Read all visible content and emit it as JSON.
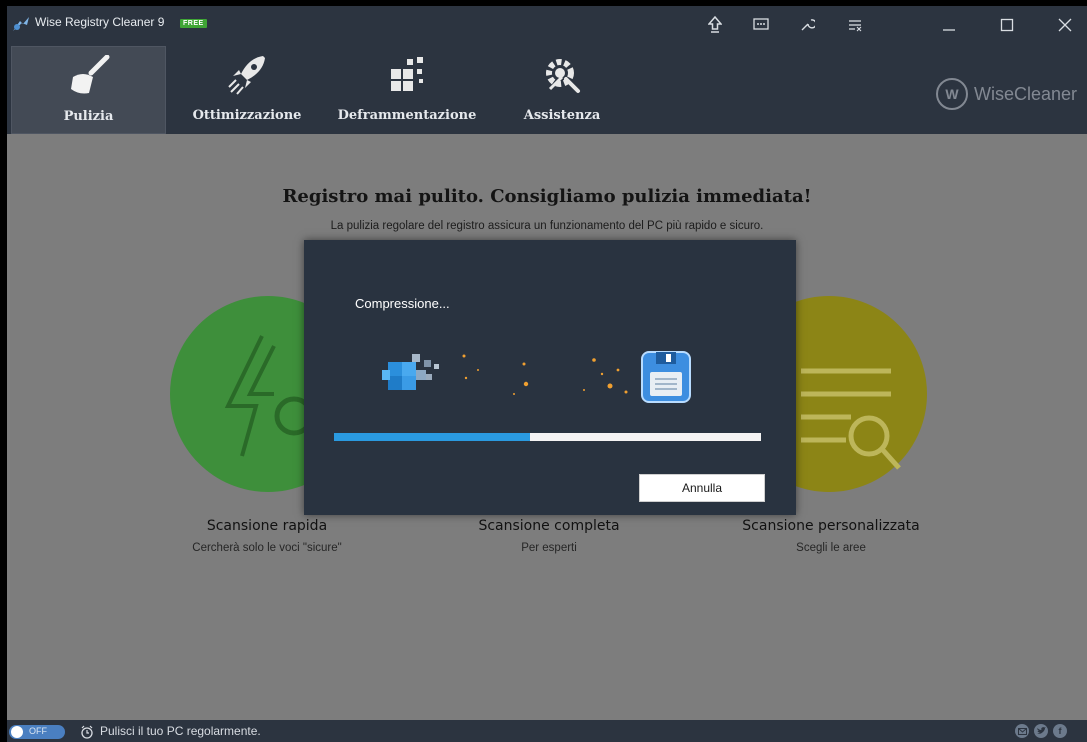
{
  "app": {
    "title": "Wise Registry Cleaner 9",
    "badge": "FREE"
  },
  "toolbar": {
    "tabs": [
      {
        "label": "Pulizia",
        "icon": "broom-icon",
        "active": true
      },
      {
        "label": "Ottimizzazione",
        "icon": "rocket-icon",
        "active": false
      },
      {
        "label": "Deframmentazione",
        "icon": "defrag-blocks-icon",
        "active": false
      },
      {
        "label": "Assistenza",
        "icon": "tools-gear-icon",
        "active": false
      }
    ],
    "brand": {
      "logo_letter": "W",
      "name": "WiseCleaner"
    }
  },
  "main": {
    "headline": "Registro mai pulito. Consigliamo pulizia immediata!",
    "subline": "La pulizia regolare del registro assicura un funzionamento del PC più rapido e sicuro.",
    "options": [
      {
        "title": "Scansione rapida",
        "subtitle": "Cercherà solo le voci \"sicure\"",
        "color": "#3e8f3b"
      },
      {
        "title": "Scansione completa",
        "subtitle": "Per esperti"
      },
      {
        "title": "Scansione personalizzata",
        "subtitle": "Scegli le aree",
        "color": "#8c8516"
      }
    ]
  },
  "dialog": {
    "title": "Compressione...",
    "progress": 0.46,
    "cancel_label": "Annulla",
    "accent": "#2a9ae0"
  },
  "statusbar": {
    "toggle_label": "OFF",
    "text": "Pulisci il tuo PC regolarmente.",
    "social": [
      {
        "icon": "email-icon"
      },
      {
        "icon": "twitter-icon"
      },
      {
        "icon": "facebook-icon",
        "letter": "f"
      }
    ]
  }
}
